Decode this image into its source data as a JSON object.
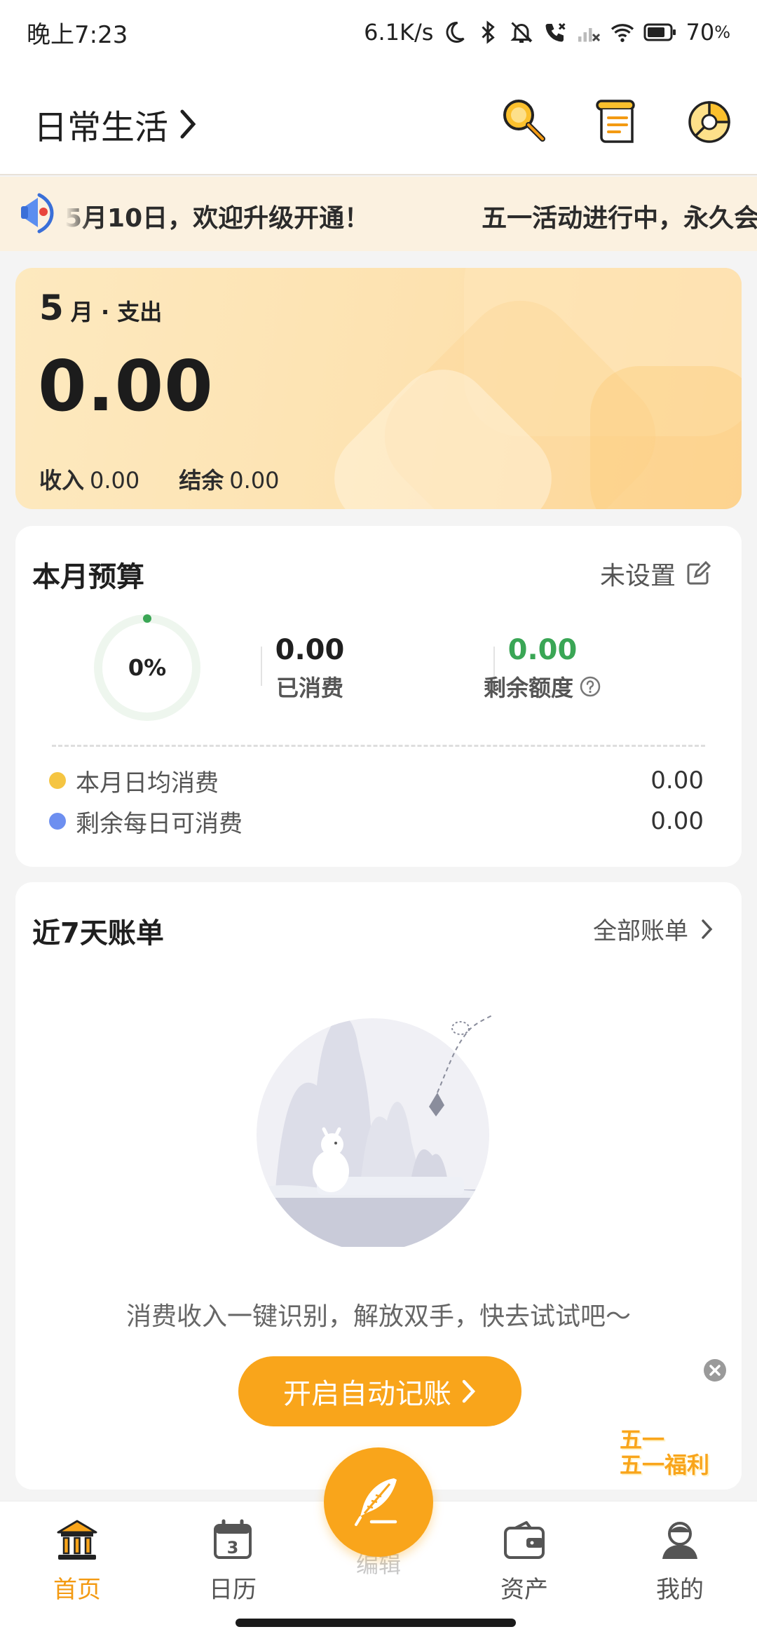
{
  "status_bar": {
    "time": "晚上7:23",
    "net_speed": "6.1K/s",
    "battery_percent": "70",
    "battery_suffix": "%"
  },
  "header": {
    "book_name": "日常生活"
  },
  "marquee": {
    "text": "5月10日，欢迎升级开通！",
    "text2": "五一活动进行中，永久会员"
  },
  "summary": {
    "month_number": "5",
    "month_label": "月 · 支出",
    "expense": "0.00",
    "income_label": "收入",
    "income_value": "0.00",
    "balance_label": "结余",
    "balance_value": "0.00"
  },
  "budget": {
    "title": "本月预算",
    "status": "未设置",
    "percent_label": "0%",
    "percent_value": 0,
    "spent_value": "0.00",
    "spent_label": "已消费",
    "remaining_value": "0.00",
    "remaining_label": "剩余额度",
    "rows": [
      {
        "label": "本月日均消费",
        "value": "0.00",
        "color": "#f5c542"
      },
      {
        "label": "剩余每日可消费",
        "value": "0.00",
        "color": "#6d8ff0"
      }
    ]
  },
  "recent": {
    "title": "近7天账单",
    "all_label": "全部账单",
    "empty_text": "消费收入一键识别，解放双手，快去试试吧～",
    "cta_label": "开启自动记账"
  },
  "promo": {
    "line1": "五一",
    "line2": "五一福利"
  },
  "nav": {
    "home": "首页",
    "calendar": "日历",
    "calendar_day": "3",
    "fab": "编辑",
    "assets": "资产",
    "mine": "我的"
  },
  "colors": {
    "accent": "#f9a51b",
    "active_nav": "#f39a12",
    "remaining_green": "#3aa655"
  }
}
